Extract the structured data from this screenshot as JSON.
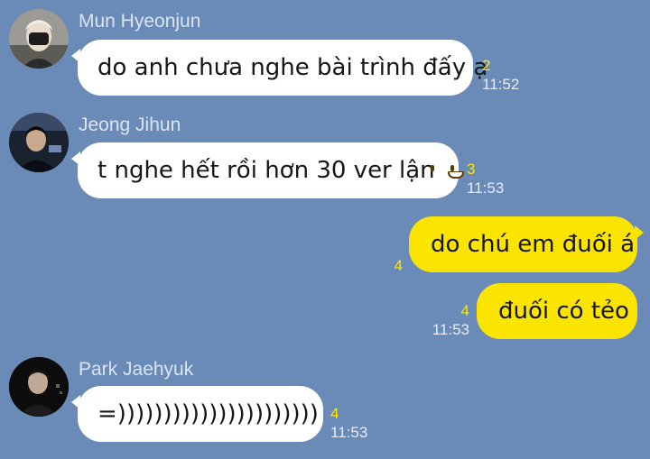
{
  "messages": [
    {
      "sender": "Mun Hyeonjun",
      "text": "do anh chưa nghe bài trình đấy ạ",
      "unread": "2",
      "time": "11:52"
    },
    {
      "sender": "Jeong Jihun",
      "text": "t nghe hết rồi hơn 30 ver lận",
      "emoji": "grinning-face",
      "unread": "3",
      "time": "11:53"
    },
    {
      "text": "do chú em đuối á",
      "unread": "4"
    },
    {
      "text": "đuối có tẻo",
      "unread": "4",
      "time": "11:53"
    },
    {
      "sender": "Park Jaehyuk",
      "text": "=))))))))))))))))))))))",
      "unread": "4",
      "time": "11:53"
    }
  ],
  "colors": {
    "background": "#6a8ab8",
    "incoming_bubble": "#ffffff",
    "outgoing_bubble": "#fbe500",
    "unread_count": "#ffe600"
  }
}
